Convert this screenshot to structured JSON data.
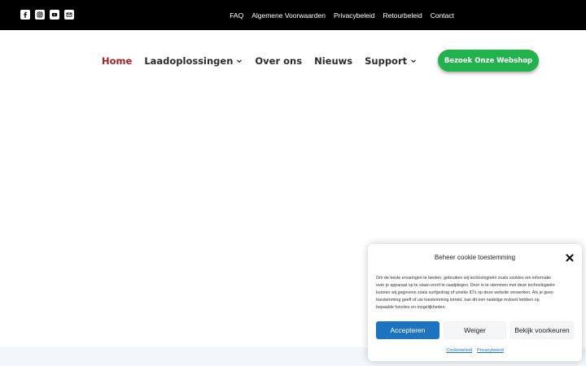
{
  "topbar": {
    "social_icons": [
      "facebook-icon",
      "instagram-icon",
      "youtube-icon",
      "mail-icon"
    ],
    "links": [
      "FAQ",
      "Algemene Voorwaarden",
      "Privacybeleid",
      "Retourbeleid",
      "Contact"
    ]
  },
  "nav": {
    "items": [
      {
        "label": "Home",
        "active": true,
        "has_dropdown": false
      },
      {
        "label": "Laadoplossingen",
        "active": false,
        "has_dropdown": true
      },
      {
        "label": "Over ons",
        "active": false,
        "has_dropdown": false
      },
      {
        "label": "Nieuws",
        "active": false,
        "has_dropdown": false
      },
      {
        "label": "Support",
        "active": false,
        "has_dropdown": true
      }
    ],
    "cta_label": "Bezoek Onze Webshop"
  },
  "cookie": {
    "title": "Beheer cookie toestemming",
    "body_lines": [
      "Om de beste ervaringen te bieden, gebruiken wij technologieën zoals cookies om informatie",
      "over je apparaat op te slaan en/of te raadplegen. Door in te stemmen met deze technologieën",
      "kunnen wij gegevens zoals surfgedrag of unieke ID's op deze website verwerken. Als je geen",
      "toestemming geeft of uw toestemming intrekt, kan dit een nadelige invloed hebben op",
      "bepaalde functies en mogelijkheden."
    ],
    "accept_label": "Accepteren",
    "deny_label": "Weiger",
    "prefs_label": "Bekijk voorkeuren",
    "links": [
      "Cookiebeleid",
      "Privacybeleid"
    ]
  },
  "colors": {
    "topbar_bg": "#000000",
    "nav_active": "#a3202b",
    "nav_text": "#2b2b2b",
    "cta_bg": "#22b14c",
    "accept_bg": "#1e73be",
    "link": "#1e73be",
    "band_bg": "#f1f7fb"
  }
}
